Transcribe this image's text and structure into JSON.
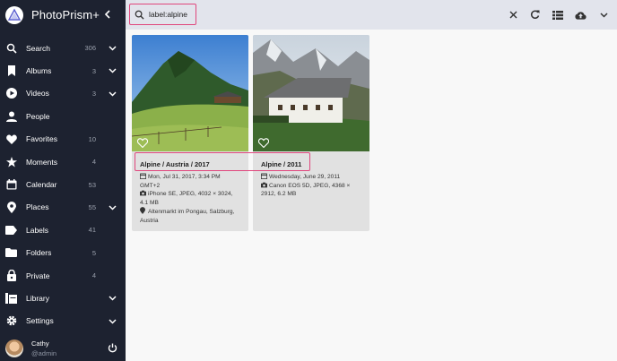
{
  "app": {
    "name": "PhotoPrism+"
  },
  "sidebar": {
    "items": [
      {
        "label": "Search",
        "count": "306",
        "icon": "search-icon",
        "chevron": true
      },
      {
        "label": "Albums",
        "count": "3",
        "icon": "bookmark-icon",
        "chevron": true
      },
      {
        "label": "Videos",
        "count": "3",
        "icon": "play-circle-icon",
        "chevron": true
      },
      {
        "label": "People",
        "count": "",
        "icon": "person-icon",
        "chevron": false
      },
      {
        "label": "Favorites",
        "count": "10",
        "icon": "heart-icon",
        "chevron": false
      },
      {
        "label": "Moments",
        "count": "4",
        "icon": "star-icon",
        "chevron": false
      },
      {
        "label": "Calendar",
        "count": "53",
        "icon": "calendar-icon",
        "chevron": false
      },
      {
        "label": "Places",
        "count": "55",
        "icon": "map-pin-icon",
        "chevron": true
      },
      {
        "label": "Labels",
        "count": "41",
        "icon": "label-icon",
        "chevron": false
      },
      {
        "label": "Folders",
        "count": "5",
        "icon": "folder-icon",
        "chevron": false
      },
      {
        "label": "Private",
        "count": "4",
        "icon": "lock-icon",
        "chevron": false
      },
      {
        "label": "Library",
        "count": "",
        "icon": "library-icon",
        "chevron": true
      },
      {
        "label": "Settings",
        "count": "",
        "icon": "gear-icon",
        "chevron": true
      }
    ],
    "user": {
      "name": "Cathy",
      "handle": "@admin"
    }
  },
  "search": {
    "value": "label:alpine"
  },
  "toolbar": {
    "icons": [
      "close-icon",
      "refresh-icon",
      "view-list-icon",
      "upload-icon",
      "chevron-down-icon"
    ]
  },
  "photos": [
    {
      "title": "Alpine / Austria / 2017",
      "date": "Mon, Jul 31, 2017, 3:34 PM",
      "tz": "GMT+2",
      "camera": "iPhone SE, JPEG, 4032 × 3024,",
      "size": "4.1 MB",
      "location": "Altenmarkt im Pongau, Salzburg,",
      "country": "Austria"
    },
    {
      "title": "Alpine / 2011",
      "date": "Wednesday, June 29, 2011",
      "camera": "Canon EOS 5D, JPEG, 4368 ×",
      "size": "2912, 6.2 MB"
    }
  ],
  "colors": {
    "sidebar": "#1d2230",
    "topbar": "#e2e4ec",
    "highlight": "#e0467c",
    "card": "#e1e1e1"
  }
}
